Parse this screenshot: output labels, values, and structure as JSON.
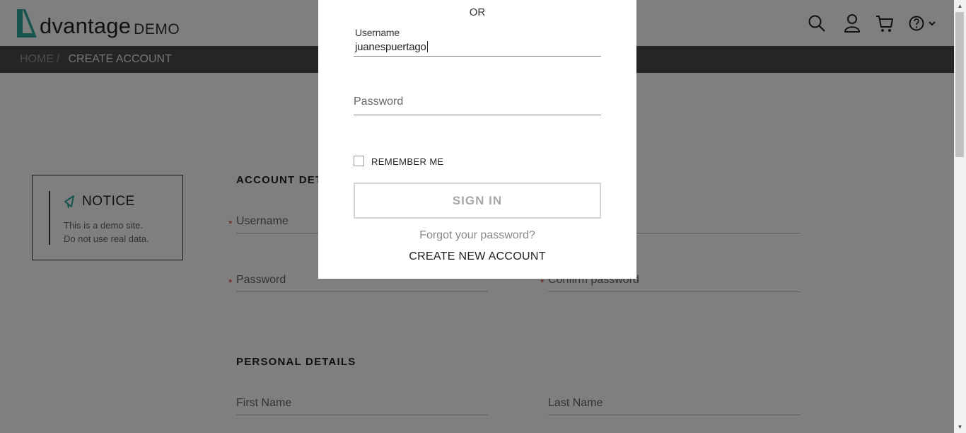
{
  "header": {
    "logo_text": "dvantage",
    "logo_suffix": "DEMO",
    "icons": [
      "search-icon",
      "user-icon",
      "cart-icon",
      "help-icon",
      "chevron-down-icon"
    ]
  },
  "breadcrumb": {
    "home": "HOME",
    "separator": "/",
    "current": "CREATE ACCOUNT"
  },
  "notice": {
    "title": "NOTICE",
    "line1": "This is a demo site.",
    "line2": "Do not use real data."
  },
  "form": {
    "account_details_title": "ACCOUNT DETAILS",
    "username_label": "Username",
    "password_label": "Password",
    "confirm_password_label": "Confirm password",
    "required_mark": "*",
    "personal_details_title": "PERSONAL DETAILS",
    "first_name_label": "First Name",
    "last_name_label": "Last Name"
  },
  "login_modal": {
    "or_text": "OR",
    "username_label": "Username",
    "username_value": "juanespuertago",
    "password_label": "Password",
    "remember_me": "REMEMBER ME",
    "remember_checked": false,
    "sign_in": "SIGN IN",
    "forgot_password": "Forgot your password?",
    "create_account": "CREATE NEW ACCOUNT"
  },
  "colors": {
    "brand_teal": "#2fa89c",
    "required_red": "#e0303a",
    "overlay": "rgba(0,0,0,0.5)"
  }
}
